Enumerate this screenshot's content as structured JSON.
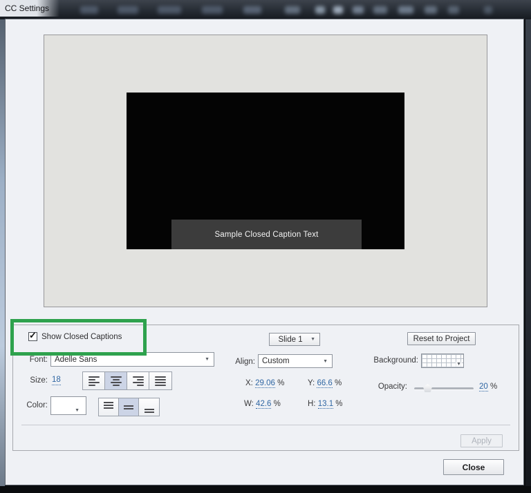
{
  "window": {
    "title": "CC Settings"
  },
  "preview": {
    "caption_text": "Sample Closed Caption Text"
  },
  "panel": {
    "show_closed_captions": {
      "label": "Show Closed Captions",
      "checked": true
    },
    "font": {
      "label": "Font:",
      "value": "Adelle Sans"
    },
    "size": {
      "label": "Size:",
      "value": "18"
    },
    "color": {
      "label": "Color:",
      "value": "#FFFFFF"
    },
    "slide": {
      "value": "Slide 1"
    },
    "align": {
      "label": "Align:",
      "value": "Custom"
    },
    "position": {
      "x": {
        "label": "X:",
        "value": "29.06",
        "unit": "%"
      },
      "y": {
        "label": "Y:",
        "value": "66.6",
        "unit": "%"
      },
      "w": {
        "label": "W:",
        "value": "42.6",
        "unit": "%"
      },
      "h": {
        "label": "H:",
        "value": "13.1",
        "unit": "%"
      }
    },
    "reset_button_label": "Reset to Project",
    "background": {
      "label": "Background:"
    },
    "opacity": {
      "label": "Opacity:",
      "value": "20",
      "unit": "%",
      "percent": 20
    },
    "apply_button_label": "Apply"
  },
  "close_button_label": "Close",
  "icons": {
    "dropdown_arrow": "▼",
    "checkmark": "✓"
  },
  "colors": {
    "highlight_green": "#2ea24d",
    "link_blue": "#2f66a3",
    "caption_background": "#3c3c3c",
    "selected_toggle": "#ccd4e6",
    "stage_black": "#040404"
  }
}
